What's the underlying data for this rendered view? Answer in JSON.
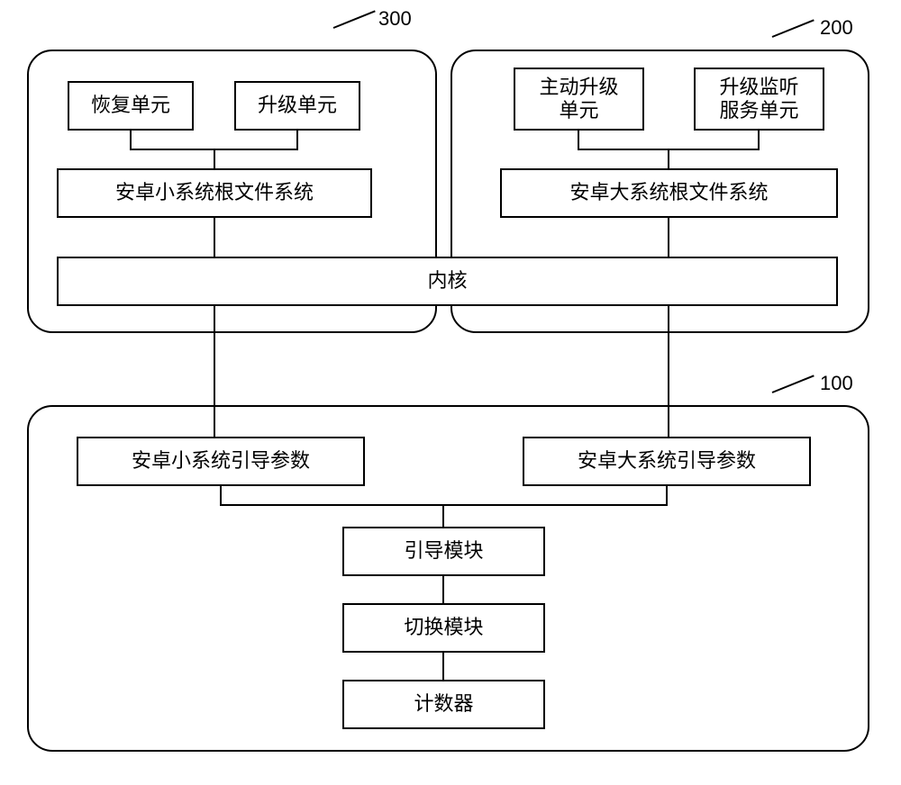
{
  "refs": {
    "r300": "300",
    "r200": "200",
    "r100": "100"
  },
  "c300": {
    "recovery_unit": "恢复单元",
    "upgrade_unit": "升级单元",
    "small_rootfs": "安卓小系统根文件系统"
  },
  "c200": {
    "active_upgrade_unit": "主动升级\n单元",
    "upgrade_listen_unit": "升级监听\n服务单元",
    "big_rootfs": "安卓大系统根文件系统"
  },
  "kernel": "内核",
  "c100": {
    "small_boot_params": "安卓小系统引导参数",
    "big_boot_params": "安卓大系统引导参数",
    "boot_module": "引导模块",
    "switch_module": "切换模块",
    "counter": "计数器"
  }
}
